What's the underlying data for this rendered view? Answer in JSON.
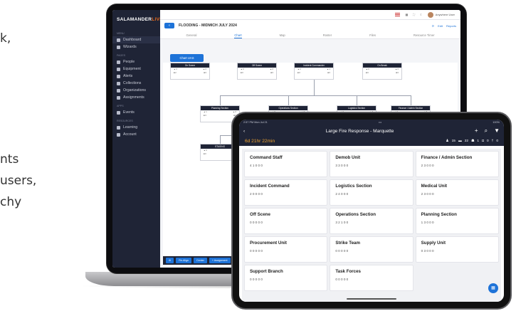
{
  "side_text": {
    "line1": "k,",
    "line2": "nts",
    "line3": "users,",
    "line4": "chy"
  },
  "laptop": {
    "brand_a": "SALAMANDER",
    "brand_b": "LIVE",
    "menu_section": "MENU",
    "pages_section": "PAGES",
    "apps_section": "APPS",
    "resources_section": "RESOURCES",
    "menu": [
      {
        "label": "Dashboard"
      },
      {
        "label": "Wizards"
      }
    ],
    "pages": [
      {
        "label": "People"
      },
      {
        "label": "Equipment"
      },
      {
        "label": "Alerts"
      },
      {
        "label": "Collections"
      },
      {
        "label": "Organizations"
      },
      {
        "label": "Assignments"
      }
    ],
    "apps": [
      {
        "label": "Events"
      }
    ],
    "resources": [
      {
        "label": "Learning"
      },
      {
        "label": "Account"
      }
    ],
    "user": "Anywhere User",
    "title": "FLOODING - MIDMICH JULY 2024",
    "edit": "Edit",
    "reports": "Reports",
    "tabs": [
      "General",
      "Chart",
      "Map",
      "Roster",
      "Files",
      "Resource Timer"
    ],
    "chart_btn": "Chart UAS",
    "boxes": [
      "On Scene",
      "Off Scene",
      "Incident Commander",
      "On Break",
      "Planning Section",
      "Operations Section",
      "Logistics Section",
      "Finance / Admin Section",
      "STAGING"
    ],
    "bottom": [
      "Re-Align",
      "Center",
      "+ Assignment"
    ]
  },
  "tablet": {
    "time": "2:57 PM  Mon Jul 21",
    "battery": "100%",
    "title": "Large Fire Response - Marquette",
    "timer": "6d 21hr 22min",
    "counts": {
      "people": "15",
      "chat": "22",
      "group": "1",
      "cam": "0",
      "person2": "0"
    },
    "cards": [
      {
        "name": "Command Staff",
        "stats": "4 1 0 0 0"
      },
      {
        "name": "Demob Unit",
        "stats": "3 3 0 0 0"
      },
      {
        "name": "Finance / Admin Section",
        "stats": "2 3 0 0 0"
      },
      {
        "name": "Incident Command",
        "stats": "2 0 0 0 0"
      },
      {
        "name": "Logistics Section",
        "stats": "2 4 0 0 0"
      },
      {
        "name": "Medical Unit",
        "stats": "2 3 0 0 0"
      },
      {
        "name": "Off Scene",
        "stats": "0 0 0 0 0"
      },
      {
        "name": "Operations Section",
        "stats": "3 2 1 0 0"
      },
      {
        "name": "Planning Section",
        "stats": "1 3 0 0 0"
      },
      {
        "name": "Procurement Unit",
        "stats": "0 0 0 0 0"
      },
      {
        "name": "Strike Team",
        "stats": "0 0 0 0 0"
      },
      {
        "name": "Supply Unit",
        "stats": "0 3 0 0 0"
      },
      {
        "name": "Support Branch",
        "stats": "0 0 0 0 0"
      },
      {
        "name": "Task Forces",
        "stats": "0 0 0 0 0"
      }
    ]
  }
}
